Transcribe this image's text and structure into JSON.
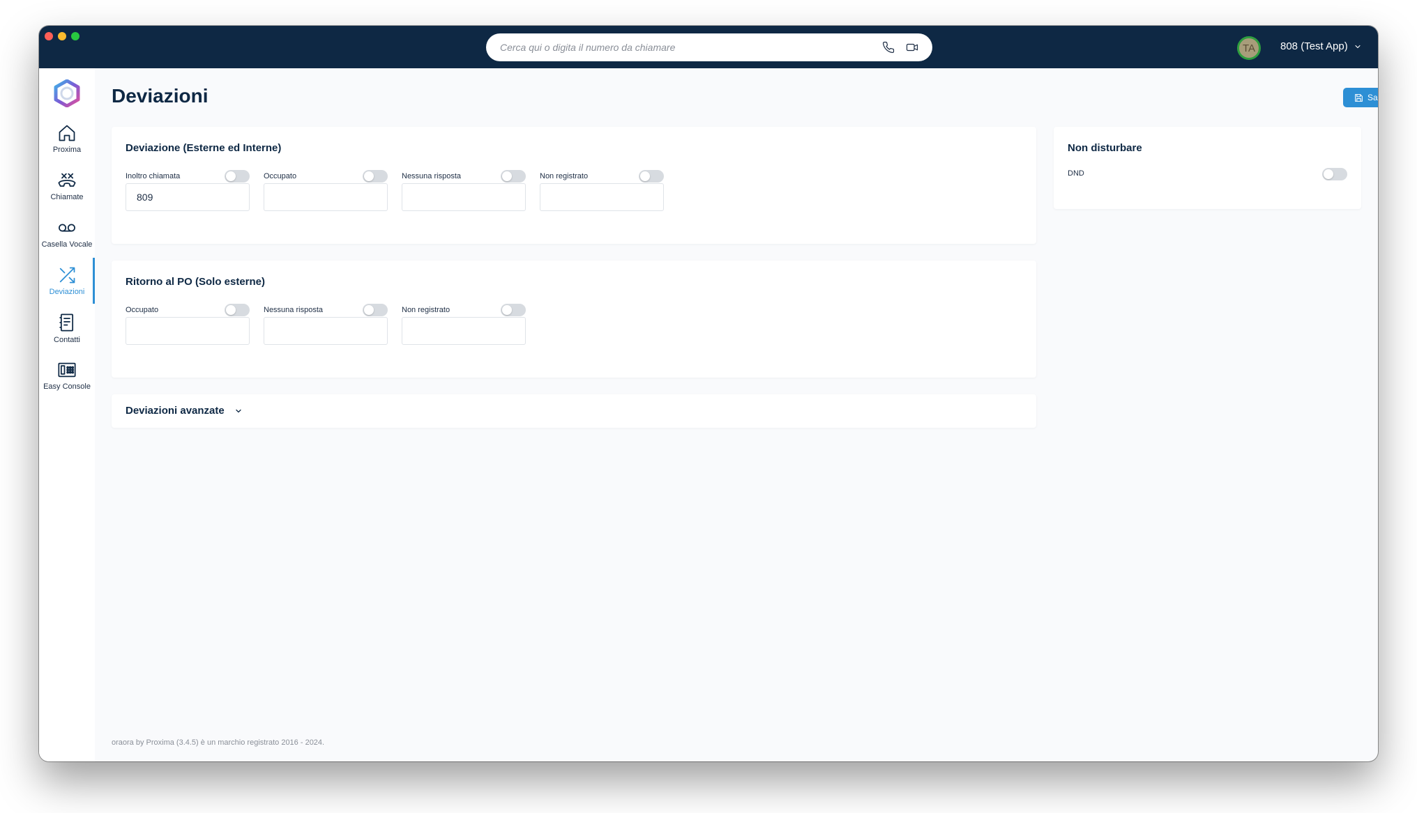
{
  "search": {
    "placeholder": "Cerca qui o digita il numero da chiamare"
  },
  "user": {
    "initials": "TA",
    "account_label": "808 (Test App)"
  },
  "sidebar": {
    "items": [
      {
        "label": "Proxima",
        "icon": "home-icon"
      },
      {
        "label": "Chiamate",
        "icon": "phone-handset-icon"
      },
      {
        "label": "Casella Vocale",
        "icon": "voicemail-icon"
      },
      {
        "label": "Deviazioni",
        "icon": "shuffle-icon",
        "active": true
      },
      {
        "label": "Contatti",
        "icon": "address-book-icon"
      },
      {
        "label": "Easy Console",
        "icon": "console-icon"
      }
    ]
  },
  "page": {
    "title": "Deviazioni",
    "save_label": "Salva"
  },
  "deviazione": {
    "title": "Deviazione (Esterne ed Interne)",
    "fields": [
      {
        "label": "Inoltro chiamata",
        "value": "809",
        "enabled": false
      },
      {
        "label": "Occupato",
        "value": "",
        "enabled": false
      },
      {
        "label": "Nessuna risposta",
        "value": "",
        "enabled": false
      },
      {
        "label": "Non registrato",
        "value": "",
        "enabled": false
      }
    ]
  },
  "ritorno": {
    "title": "Ritorno al PO (Solo esterne)",
    "fields": [
      {
        "label": "Occupato",
        "value": "",
        "enabled": false
      },
      {
        "label": "Nessuna risposta",
        "value": "",
        "enabled": false
      },
      {
        "label": "Non registrato",
        "value": "",
        "enabled": false
      }
    ]
  },
  "advanced": {
    "label": "Deviazioni avanzate"
  },
  "dnd": {
    "title": "Non disturbare",
    "label": "DND",
    "enabled": false
  },
  "footer": {
    "text": "oraora by Proxima (3.4.5) è un marchio registrato 2016 - 2024."
  },
  "colors": {
    "topbar": "#0e2844",
    "accent": "#2d8fd5",
    "background": "#f9fafc"
  }
}
